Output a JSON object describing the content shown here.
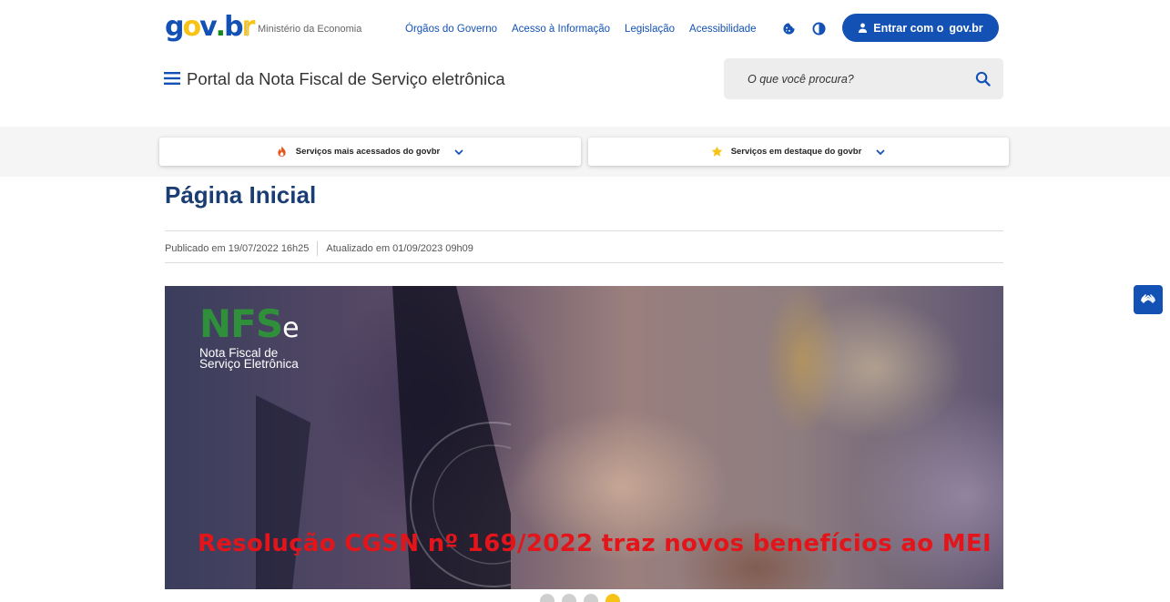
{
  "header": {
    "logo": {
      "g": "g",
      "o": "o",
      "v": "v",
      "dot": ".",
      "b": "b",
      "r": "r"
    },
    "ministry": "Ministério da Economia",
    "links": [
      "Órgãos do Governo",
      "Acesso à Informação",
      "Legislação",
      "Acessibilidade"
    ],
    "cookie_icon": "cookie-icon",
    "contrast_icon": "contrast-icon",
    "login_label": "Entrar com o",
    "login_brand": "gov.br",
    "portal_title": "Portal da Nota Fiscal de Serviço eletrônica",
    "search_placeholder": "O que você procura?",
    "colors": {
      "primary": "#1351b4",
      "logo_g": "#1351b4",
      "logo_o": "#f8c317",
      "logo_v": "#1351b4",
      "logo_dot": "#168821",
      "logo_b": "#1351b4",
      "logo_r": "#f8c317"
    }
  },
  "services": {
    "most_accessed": "Serviços mais acessados do govbr",
    "featured": "Serviços em destaque do govbr"
  },
  "page": {
    "title": "Página Inicial",
    "published": "Publicado em 19/07/2022 16h25",
    "updated": "Atualizado em 01/09/2023 09h09"
  },
  "banner": {
    "logo_letters": {
      "n": "N",
      "f": "F",
      "s": "S",
      "e": "e"
    },
    "logo_line1": "Nota Fiscal de",
    "logo_line2": "Serviço Eletrônica",
    "caption": "Resolução CGSN nº 169/2022 traz novos benefícios ao MEI",
    "caption_color": "#e3151a"
  },
  "carousel": {
    "slides": 4,
    "active": 4
  }
}
